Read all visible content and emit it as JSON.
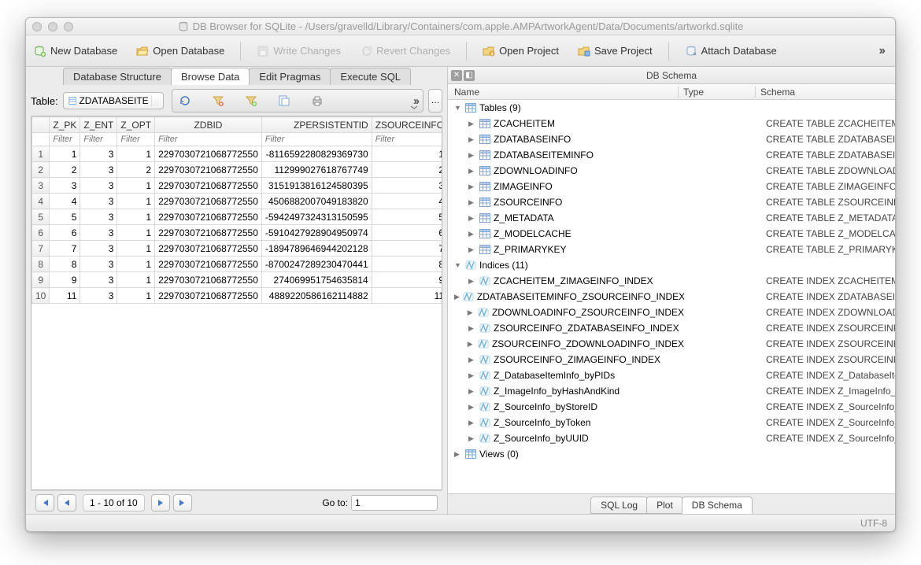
{
  "titlebar": {
    "title": "DB Browser for SQLite - /Users/gravelld/Library/Containers/com.apple.AMPArtworkAgent/Data/Documents/artworkd.sqlite"
  },
  "toolbar": {
    "new_db": "New Database",
    "open_db": "Open Database",
    "write": "Write Changes",
    "revert": "Revert Changes",
    "open_proj": "Open Project",
    "save_proj": "Save Project",
    "attach": "Attach Database"
  },
  "main_tabs": {
    "db_structure": "Database Structure",
    "browse_data": "Browse Data",
    "edit_pragmas": "Edit Pragmas",
    "execute_sql": "Execute SQL"
  },
  "table_bar": {
    "label": "Table:",
    "selected": "ZDATABASEITE"
  },
  "grid": {
    "columns": [
      "Z_PK",
      "Z_ENT",
      "Z_OPT",
      "ZDBID",
      "ZPERSISTENTID",
      "ZSOURCEINFO"
    ],
    "filter_placeholder": "Filter",
    "rows": [
      {
        "n": "1",
        "pk": "1",
        "ent": "3",
        "opt": "1",
        "dbid": "2297030721068772550",
        "persist": "-8116592280829369730",
        "src": "1"
      },
      {
        "n": "2",
        "pk": "2",
        "ent": "3",
        "opt": "2",
        "dbid": "2297030721068772550",
        "persist": "112999027618767749",
        "src": "2"
      },
      {
        "n": "3",
        "pk": "3",
        "ent": "3",
        "opt": "1",
        "dbid": "2297030721068772550",
        "persist": "3151913816124580395",
        "src": "3"
      },
      {
        "n": "4",
        "pk": "4",
        "ent": "3",
        "opt": "1",
        "dbid": "2297030721068772550",
        "persist": "4506882007049183820",
        "src": "4"
      },
      {
        "n": "5",
        "pk": "5",
        "ent": "3",
        "opt": "1",
        "dbid": "2297030721068772550",
        "persist": "-5942497324313150595",
        "src": "5"
      },
      {
        "n": "6",
        "pk": "6",
        "ent": "3",
        "opt": "1",
        "dbid": "2297030721068772550",
        "persist": "-5910427928904950974",
        "src": "6"
      },
      {
        "n": "7",
        "pk": "7",
        "ent": "3",
        "opt": "1",
        "dbid": "2297030721068772550",
        "persist": "-1894789646944202128",
        "src": "7"
      },
      {
        "n": "8",
        "pk": "8",
        "ent": "3",
        "opt": "1",
        "dbid": "2297030721068772550",
        "persist": "-8700247289230470441",
        "src": "8"
      },
      {
        "n": "9",
        "pk": "9",
        "ent": "3",
        "opt": "1",
        "dbid": "2297030721068772550",
        "persist": "274069951754635814",
        "src": "9"
      },
      {
        "n": "10",
        "pk": "11",
        "ent": "3",
        "opt": "1",
        "dbid": "2297030721068772550",
        "persist": "4889220586162114882",
        "src": "11"
      }
    ]
  },
  "pager": {
    "range": "1 - 10 of 10",
    "goto_label": "Go to:",
    "goto_value": "1"
  },
  "right_panel": {
    "title": "DB Schema",
    "head_name": "Name",
    "head_type": "Type",
    "head_schema": "Schema",
    "tables_label": "Tables (9)",
    "indices_label": "Indices (11)",
    "views_label": "Views (0)",
    "tables": [
      {
        "name": "ZCACHEITEM",
        "sql": "CREATE TABLE ZCACHEITEM"
      },
      {
        "name": "ZDATABASEINFO",
        "sql": "CREATE TABLE ZDATABASEI"
      },
      {
        "name": "ZDATABASEITEMINFO",
        "sql": "CREATE TABLE ZDATABASEI"
      },
      {
        "name": "ZDOWNLOADINFO",
        "sql": "CREATE TABLE ZDOWNLOAD"
      },
      {
        "name": "ZIMAGEINFO",
        "sql": "CREATE TABLE ZIMAGEINFO ("
      },
      {
        "name": "ZSOURCEINFO",
        "sql": "CREATE TABLE ZSOURCEINFO"
      },
      {
        "name": "Z_METADATA",
        "sql": "CREATE TABLE Z_METADATA ("
      },
      {
        "name": "Z_MODELCACHE",
        "sql": "CREATE TABLE Z_MODELCAC"
      },
      {
        "name": "Z_PRIMARYKEY",
        "sql": "CREATE TABLE Z_PRIMARYKE"
      }
    ],
    "indices": [
      {
        "name": "ZCACHEITEM_ZIMAGEINFO_INDEX",
        "sql": "CREATE INDEX ZCACHEITEM_"
      },
      {
        "name": "ZDATABASEITEMINFO_ZSOURCEINFO_INDEX",
        "sql": "CREATE INDEX ZDATABASEIT"
      },
      {
        "name": "ZDOWNLOADINFO_ZSOURCEINFO_INDEX",
        "sql": "CREATE INDEX ZDOWNLOAD"
      },
      {
        "name": "ZSOURCEINFO_ZDATABASEINFO_INDEX",
        "sql": "CREATE INDEX ZSOURCEINFO"
      },
      {
        "name": "ZSOURCEINFO_ZDOWNLOADINFO_INDEX",
        "sql": "CREATE INDEX ZSOURCEINFO"
      },
      {
        "name": "ZSOURCEINFO_ZIMAGEINFO_INDEX",
        "sql": "CREATE INDEX ZSOURCEINFO"
      },
      {
        "name": "Z_DatabaseItemInfo_byPIDs",
        "sql": "CREATE INDEX Z_DatabaseIte"
      },
      {
        "name": "Z_ImageInfo_byHashAndKind",
        "sql": "CREATE INDEX Z_ImageInfo_b"
      },
      {
        "name": "Z_SourceInfo_byStoreID",
        "sql": "CREATE INDEX Z_SourceInfo_"
      },
      {
        "name": "Z_SourceInfo_byToken",
        "sql": "CREATE INDEX Z_SourceInfo_"
      },
      {
        "name": "Z_SourceInfo_byUUID",
        "sql": "CREATE INDEX Z_SourceInfo_"
      }
    ]
  },
  "right_tabs": {
    "sqllog": "SQL Log",
    "plot": "Plot",
    "dbschema": "DB Schema"
  },
  "statusbar": {
    "encoding": "UTF-8"
  }
}
